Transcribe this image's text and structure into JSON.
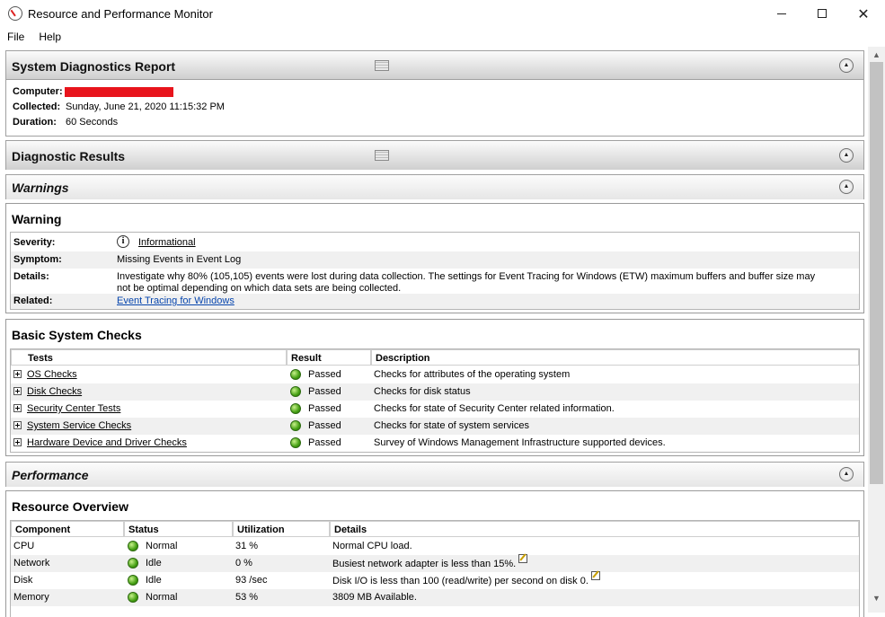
{
  "window": {
    "title": "Resource and Performance Monitor"
  },
  "menu": [
    "File",
    "Help"
  ],
  "report": {
    "header": "System Diagnostics Report",
    "computer_label": "Computer:",
    "collected_label": "Collected:",
    "collected_value": "Sunday, June 21, 2020 11:15:32 PM",
    "duration_label": "Duration:",
    "duration_value": "60 Seconds"
  },
  "diagnostic_results": {
    "header": "Diagnostic Results"
  },
  "warnings": {
    "header": "Warnings",
    "warning_title": "Warning",
    "severity_label": "Severity:",
    "severity_value": "Informational",
    "symptom_label": "Symptom:",
    "symptom_value": "Missing Events in Event Log",
    "details_label": "Details:",
    "details_line1": "Investigate why 80% (105,105) events were lost during data collection. The settings for Event Tracing for Windows (ETW) maximum buffers and buffer size may",
    "details_line2": "not be optimal depending on which data sets are being collected.",
    "related_label": "Related:",
    "related_value": "Event Tracing for Windows"
  },
  "basic_checks": {
    "title": "Basic System Checks",
    "columns": [
      "Tests",
      "Result",
      "Description"
    ],
    "rows": [
      {
        "test": "OS Checks",
        "result": "Passed",
        "description": "Checks for attributes of the operating system"
      },
      {
        "test": "Disk Checks",
        "result": "Passed",
        "description": "Checks for disk status"
      },
      {
        "test": "Security Center Tests",
        "result": "Passed",
        "description": "Checks for state of Security Center related information."
      },
      {
        "test": "System Service Checks",
        "result": "Passed",
        "description": "Checks for state of system services"
      },
      {
        "test": "Hardware Device and Driver Checks",
        "result": "Passed",
        "description": "Survey of Windows Management Infrastructure supported devices."
      }
    ]
  },
  "performance": {
    "header": "Performance"
  },
  "resource_overview": {
    "title": "Resource Overview",
    "columns": [
      "Component",
      "Status",
      "Utilization",
      "Details"
    ],
    "rows": [
      {
        "component": "CPU",
        "status": "Normal",
        "utilization": "31 %",
        "details": "Normal CPU load."
      },
      {
        "component": "Network",
        "status": "Idle",
        "utilization": "0 %",
        "details": "Busiest network adapter is less than 15%."
      },
      {
        "component": "Disk",
        "status": "Idle",
        "utilization": "93 /sec",
        "details": "Disk I/O is less than 100 (read/write) per second on disk 0."
      },
      {
        "component": "Memory",
        "status": "Normal",
        "utilization": "53 %",
        "details": "3809 MB Available."
      }
    ]
  },
  "colors": {
    "status_ok": "#45a013",
    "link": "#0645ad",
    "redaction": "#e8141c"
  }
}
